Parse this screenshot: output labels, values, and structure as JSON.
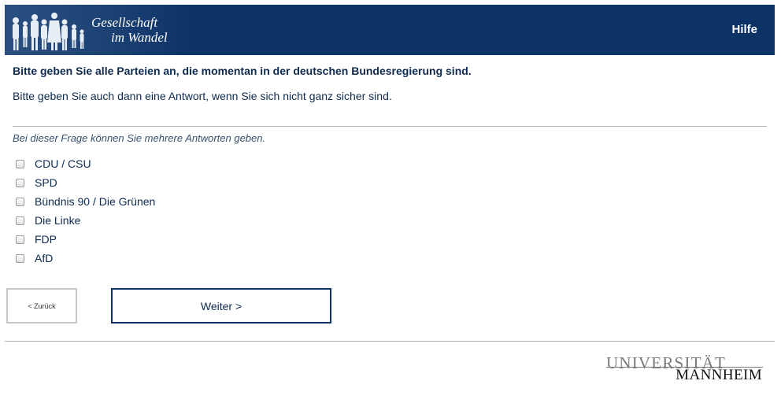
{
  "header": {
    "logo_line1": "Gesellschaft",
    "logo_line2": "im Wandel",
    "help_label": "Hilfe",
    "background_color": "#0d3266"
  },
  "question": {
    "title": "Bitte geben Sie alle Parteien an, die momentan in der deutschen Bundesregierung sind.",
    "hint": "Bitte geben Sie auch dann eine Antwort, wenn Sie sich nicht ganz sicher sind.",
    "instruction": "Bei dieser Frage können Sie mehrere Antworten geben.",
    "options": [
      {
        "label": "CDU / CSU",
        "checked": false
      },
      {
        "label": "SPD",
        "checked": false
      },
      {
        "label": "Bündnis 90 / Die Grünen",
        "checked": false
      },
      {
        "label": "Die Linke",
        "checked": false
      },
      {
        "label": "FDP",
        "checked": false
      },
      {
        "label": "AfD",
        "checked": false
      }
    ]
  },
  "nav": {
    "back_label": "< Zurück",
    "next_label": "Weiter >"
  },
  "footer": {
    "uni_line1": "UNIVERSITÄT",
    "uni_line2": "MANNHEIM"
  }
}
